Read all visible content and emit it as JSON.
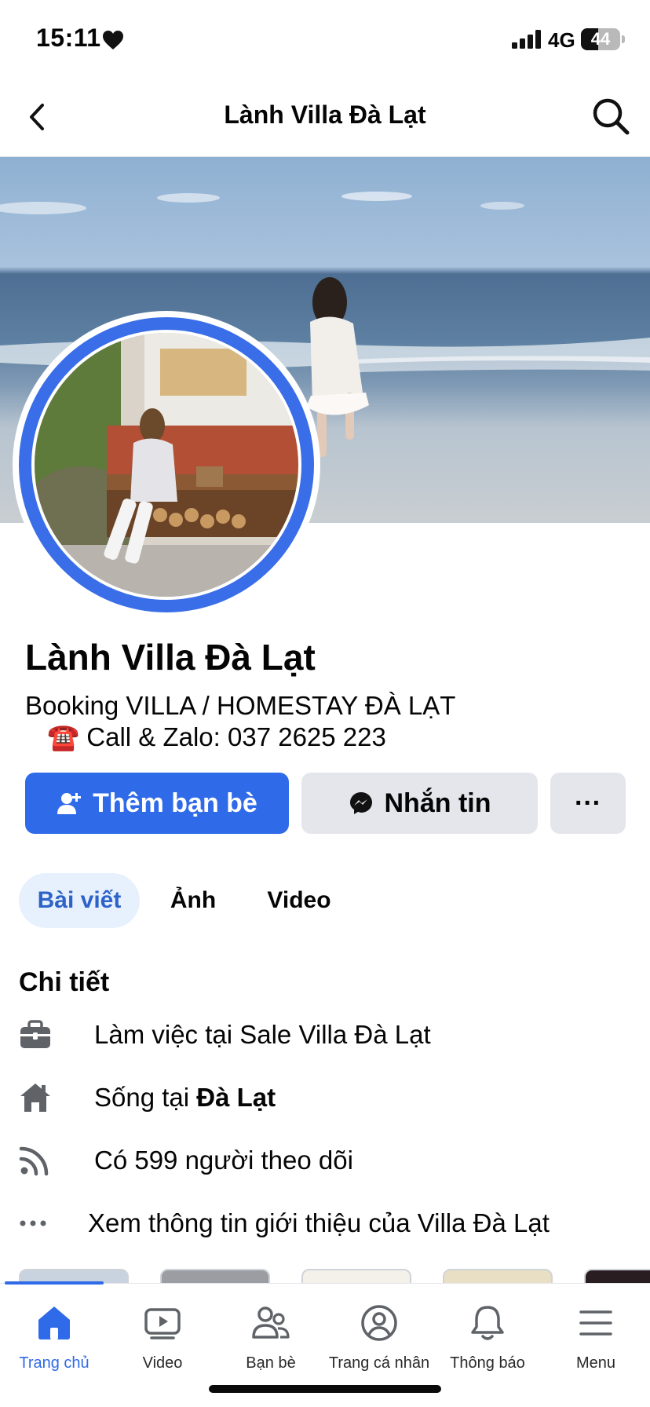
{
  "status_bar": {
    "time": "15:11",
    "network": "4G",
    "battery_level": "44",
    "battery_fraction": 0.44
  },
  "header": {
    "title": "Lành Villa Đà Lạt",
    "back_icon": "chevron-left-icon",
    "search_icon": "search-icon"
  },
  "profile": {
    "name": "Lành Villa Đà Lạt",
    "bio_line1": "Booking VILLA / HOMESTAY ĐÀ LẠT",
    "bio_line2": "☎️ Call & Zalo: 037 2625 223"
  },
  "actions": {
    "add_friend_label": "Thêm bạn bè",
    "message_label": "Nhắn tin",
    "more_label": "···"
  },
  "tabs": [
    {
      "label": "Bài viết",
      "active": true
    },
    {
      "label": "Ảnh",
      "active": false
    },
    {
      "label": "Video",
      "active": false
    }
  ],
  "details": {
    "title": "Chi tiết",
    "work": "Làm việc tại Sale Villa Đà Lạt",
    "lives_prefix": "Sống tại ",
    "lives_place": "Đà Lạt",
    "followers": "Có 599 người theo dõi",
    "more_link": "Xem thông tin giới thiệu của Villa Đà Lạt"
  },
  "bottom_nav": [
    {
      "label": "Trang chủ",
      "icon": "home-icon",
      "active": true
    },
    {
      "label": "Video",
      "icon": "video-icon",
      "active": false
    },
    {
      "label": "Bạn bè",
      "icon": "friends-icon",
      "active": false
    },
    {
      "label": "Trang cá nhân",
      "icon": "profile-icon",
      "active": false
    },
    {
      "label": "Thông báo",
      "icon": "bell-icon",
      "active": false
    },
    {
      "label": "Menu",
      "icon": "menu-icon",
      "active": false
    }
  ],
  "colors": {
    "accent": "#2f6ae8",
    "button_gray": "#e4e6eb",
    "tab_active_bg": "#e7f0fd"
  }
}
